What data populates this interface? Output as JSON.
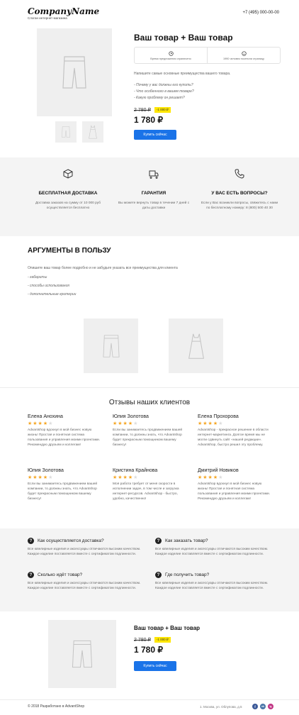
{
  "header": {
    "logo": "CompanyName",
    "tagline": "Слоган интернет-магазина",
    "phone": "+7 (495) 000-00-00"
  },
  "product": {
    "title": "Ваш товар + Ваш товар",
    "info1": "Время предложения ограничено",
    "info2": "1990 человек посетили страницу",
    "intro": "Напишите самые основные преимущества вашего товара.",
    "q1": "- Почему у вас должны его купить?",
    "q2": "- Что особенного в вашем товаре?",
    "q3": "- Какую проблему он решает?",
    "old_price": "2 780 ₽",
    "discount": "-1 000 ₽",
    "price": "1 780 ₽",
    "buy": "Купить сейчас"
  },
  "features": [
    {
      "title": "БЕСПЛАТНАЯ ДОСТАВКА",
      "text": "Доставка заказов на сумму от 10 000 руб осуществляется бесплатно"
    },
    {
      "title": "ГАРАНТИЯ",
      "text": "Вы можете вернуть товар в течении 7 дней с даты доставки"
    },
    {
      "title": "У ВАС ЕСТЬ ВОПРОСЫ?",
      "text": "Если у Вас возникли вопросы, свяжитесь с нами по бесплатному номеру: 8 (800) 500 40 30"
    }
  ],
  "arguments": {
    "title": "АРГУМЕНТЫ В ПОЛЬЗУ",
    "text": "Опишите ваш товар более подробно и не забудьте указать все преимущества для клиента",
    "item1": "- габариты",
    "item2": "- способы использования",
    "item3": "- дополнительные критерии"
  },
  "reviews": {
    "title": "Отзывы наших клиентов",
    "items": [
      {
        "name": "Елена Анохина",
        "text": "Advantshop вдохнул в мой бизнес новую жизнь! Простая и понятная система пользования и управления моими проектами. Рекомендую друзьям и коллегам!"
      },
      {
        "name": "Юлия Золотова",
        "text": "Если вы занимаетесь продвижением вашей компании, то должны знать, что Advantshop будет прекрасным помощником вашему бизнесу!"
      },
      {
        "name": "Елена Прохорова",
        "text": "Advantshop - прекрасное решение в области интернет-маркетинга. Долгое время мы не могли сдвинуть сайт «нашей редакции». Advantshop, быстро решил эту проблему."
      },
      {
        "name": "Юлия Золотова",
        "text": "Если вы занимаетесь продвижением вашей компании, то должны знать, что Advantshop будет прекрасным помощником вашему бизнесу!"
      },
      {
        "name": "Кристина Крайнова",
        "text": "Моя работа требует от меня скорости в исполнении задач, в том числе и загрузка интернет-ресурсов. Advantshop - быстро, удобно, качественно!"
      },
      {
        "name": "Дмитрий Новиков",
        "text": "Advantshop вдохнул в мой бизнес новую жизнь! Простая и понятная система пользования и управления моими проектами. Рекомендую друзьям и коллегам!"
      }
    ]
  },
  "faq": [
    {
      "q": "Как осуществляется доставка?",
      "a": "Все ювелирные изделия и аксессуары отличаются высоким качеством. Каждое изделие поставляется вместе с сертификатом подлинности."
    },
    {
      "q": "Как заказать товар?",
      "a": "Все ювелирные изделия и аксессуары отличаются высоким качеством. Каждое изделие поставляется вместе с сертификатом подлинности."
    },
    {
      "q": "Сколько идёт товар?",
      "a": "Все ювелирные изделия и аксессуары отличаются высоким качеством. Каждое изделие поставляется вместе с сертификатом подлинности."
    },
    {
      "q": "Где получить товар?",
      "a": "Все ювелирные изделия и аксессуары отличаются высоким качеством. Каждое изделие поставляется вместе с сертификатом подлинности."
    }
  ],
  "product2": {
    "title": "Ваш товар + Ваш товар",
    "old_price": "2 780 ₽",
    "discount": "-1 000 ₽",
    "price": "1 780 ₽",
    "buy": "Купить сейчас"
  },
  "footer": {
    "copyright": "© 2018 Разработано в AdvantShop",
    "address": "1. Москва, ул. Облупова, д.5",
    "social": [
      "f",
      "vk",
      "ig"
    ],
    "colors": {
      "fb": "#3b5998",
      "vk": "#4a76a8",
      "ig": "#c13584",
      "accent": "#1a73e8"
    }
  }
}
